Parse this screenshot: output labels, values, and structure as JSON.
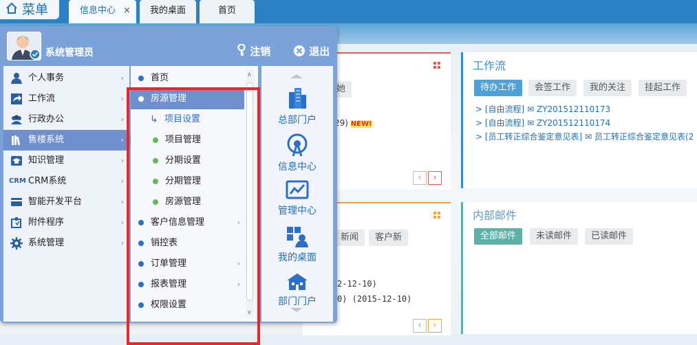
{
  "top": {
    "menu_label": "菜单",
    "tabs": [
      {
        "label": "信息中心",
        "close": "×"
      },
      {
        "label": "我的桌面"
      },
      {
        "label": "首页"
      }
    ]
  },
  "background": {
    "card1": {
      "btn_partial": "她",
      "text_partial": "29)",
      "new_badge": "NEW!"
    },
    "workflow": {
      "title": "工作流",
      "filters": [
        "待办工作",
        "会签工作",
        "我的关注",
        "挂起工作"
      ],
      "items": [
        {
          "tag": "[自由流程]",
          "code": "ZY201512110173"
        },
        {
          "tag": "[自由流程]",
          "code": "ZY201512110174"
        },
        {
          "tag": "[员工转正综合鉴定意见表]",
          "code": "员工转正综合鉴定意见表(2"
        }
      ]
    },
    "card3": {
      "tabs": [
        "新闻",
        "客户新"
      ],
      "line1": "2-12-10)",
      "line2": "0) (2015-12-10)"
    },
    "mail": {
      "title": "内部邮件",
      "filters": [
        "全部邮件",
        "未读邮件",
        "已读邮件"
      ]
    },
    "nav_prev": "‹",
    "nav_next": "›"
  },
  "popup": {
    "user_name": "系统管理员",
    "logout_label": "注销",
    "exit_label": "退出",
    "left_menu": [
      {
        "label": "个人事务",
        "icon": "user-icon"
      },
      {
        "label": "工作流",
        "icon": "workflow-arrow-icon"
      },
      {
        "label": "行政办公",
        "icon": "group-icon"
      },
      {
        "label": "售楼系统",
        "icon": "books-icon"
      },
      {
        "label": "知识管理",
        "icon": "cap-icon"
      },
      {
        "label": "CRM系统",
        "icon": "crm-icon"
      },
      {
        "label": "智能开发平台",
        "icon": "card-icon"
      },
      {
        "label": "附件程序",
        "icon": "plugin-icon"
      },
      {
        "label": "系统管理",
        "icon": "gear-icon"
      }
    ],
    "mid_menu": [
      {
        "label": "首页",
        "kind": "item",
        "chevron": false
      },
      {
        "label": "房源管理",
        "kind": "selected",
        "chevron": true
      },
      {
        "label": "项目设置",
        "kind": "subselected"
      },
      {
        "label": "项目管理",
        "kind": "sub"
      },
      {
        "label": "分期设置",
        "kind": "sub"
      },
      {
        "label": "分期管理",
        "kind": "sub"
      },
      {
        "label": "房源管理",
        "kind": "sub"
      },
      {
        "label": "客户信息管理",
        "kind": "item",
        "chevron": true
      },
      {
        "label": "销控表",
        "kind": "item",
        "chevron": false
      },
      {
        "label": "订单管理",
        "kind": "item",
        "chevron": true
      },
      {
        "label": "报表管理",
        "kind": "item",
        "chevron": true
      },
      {
        "label": "权限设置",
        "kind": "item",
        "chevron": false
      }
    ],
    "portals": [
      {
        "label": "总部门户",
        "icon": "buildings-icon"
      },
      {
        "label": "信息中心",
        "icon": "broadcast-icon"
      },
      {
        "label": "管理中心",
        "icon": "chart-icon"
      },
      {
        "label": "我的桌面",
        "icon": "desktop-icon"
      },
      {
        "label": "部门门户",
        "icon": "house-icon"
      }
    ],
    "highlight_color": "#e8262b",
    "selected_color": "#6f8fcf"
  }
}
